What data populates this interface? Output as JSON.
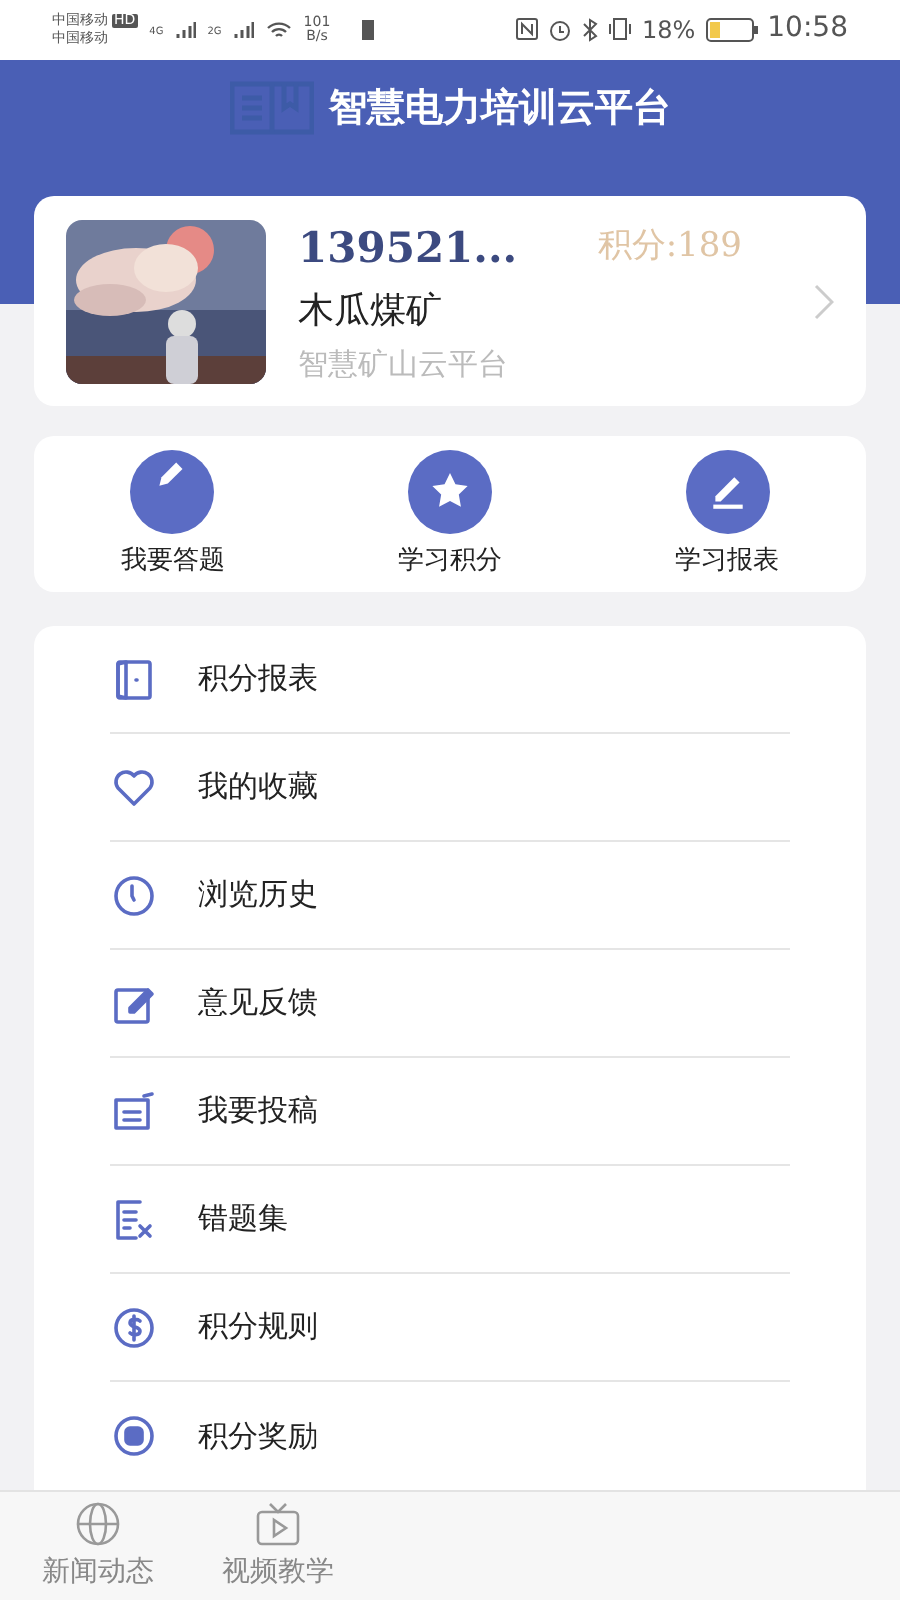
{
  "status_bar": {
    "carrier_1": "中国移动",
    "hd": "HD",
    "carrier_2": "中国移动",
    "net_1": "4G",
    "net_2": "2G",
    "speed_value": "101",
    "speed_unit": "B/s",
    "battery": "18%",
    "time": "10:58"
  },
  "header": {
    "title": "智慧电力培训云平台"
  },
  "profile": {
    "account": "139521...",
    "points": "积分:189",
    "name": "木瓜煤矿",
    "org": "智慧矿山云平台"
  },
  "actions": [
    {
      "label": "我要答题"
    },
    {
      "label": "学习积分"
    },
    {
      "label": "学习报表"
    }
  ],
  "menu": [
    {
      "label": "积分报表"
    },
    {
      "label": "我的收藏"
    },
    {
      "label": "浏览历史"
    },
    {
      "label": "意见反馈"
    },
    {
      "label": "我要投稿"
    },
    {
      "label": "错题集"
    },
    {
      "label": "积分规则"
    },
    {
      "label": "积分奖励"
    }
  ],
  "tab_bar": [
    {
      "label": "新闻动态"
    },
    {
      "label": "视频教学"
    }
  ]
}
